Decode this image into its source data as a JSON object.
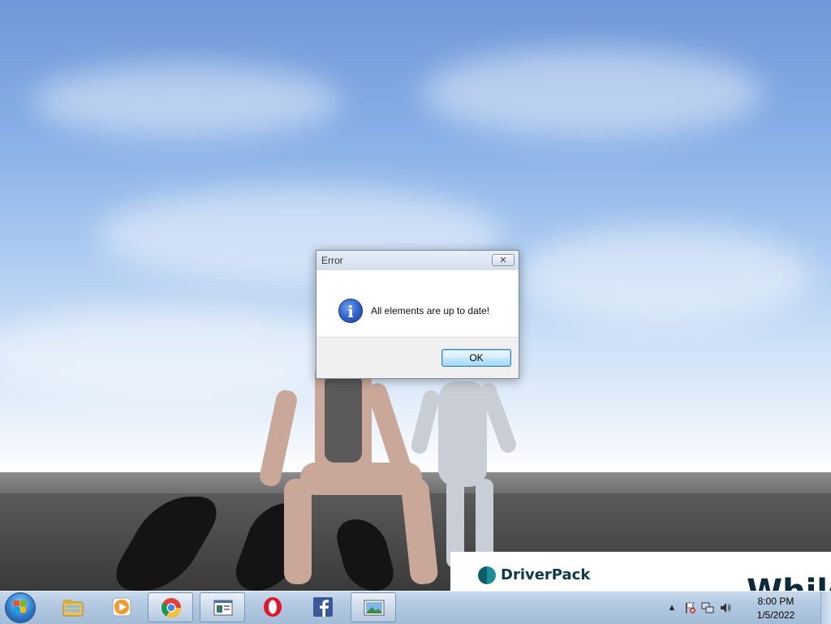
{
  "dialog": {
    "title": "Error",
    "close_glyph": "✕",
    "icon": "info-icon",
    "icon_glyph": "i",
    "message": "All elements are up to date!",
    "ok_label": "OK"
  },
  "overlay": {
    "brand": "DriverPack",
    "heading_partial": "While"
  },
  "taskbar": {
    "pinned": [
      {
        "name": "windows-explorer-icon"
      },
      {
        "name": "windows-media-player-icon"
      },
      {
        "name": "chrome-icon"
      },
      {
        "name": "app-window-icon"
      },
      {
        "name": "opera-icon"
      },
      {
        "name": "facebook-icon"
      },
      {
        "name": "image-viewer-icon"
      }
    ],
    "tray": {
      "show_hidden_glyph": "▲",
      "time": "8:00 PM",
      "date": "1/5/2022"
    }
  },
  "colors": {
    "accent": "#3c7fb1",
    "taskbar": "#b3c9e1",
    "info_icon": "#2d5fc7",
    "brand": "#0d3b4a"
  }
}
